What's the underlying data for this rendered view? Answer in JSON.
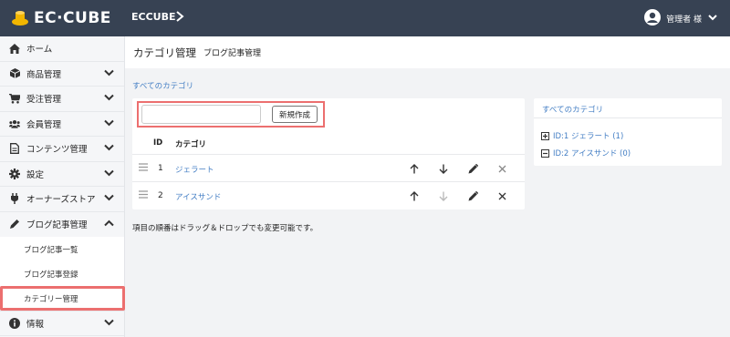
{
  "topbar": {
    "logo_text": "EC·CUBE",
    "shop_name": "ECCUBE",
    "user_name": "管理者 様"
  },
  "sidebar": {
    "items": [
      {
        "label": "ホーム",
        "icon": "home-icon"
      },
      {
        "label": "商品管理",
        "icon": "box-icon"
      },
      {
        "label": "受注管理",
        "icon": "cart-icon"
      },
      {
        "label": "会員管理",
        "icon": "users-icon"
      },
      {
        "label": "コンテンツ管理",
        "icon": "file-icon"
      },
      {
        "label": "設定",
        "icon": "gear-icon"
      },
      {
        "label": "オーナーズストア",
        "icon": "plug-icon"
      },
      {
        "label": "ブログ記事管理",
        "icon": "pen-icon"
      },
      {
        "label": "情報",
        "icon": "info-icon"
      }
    ],
    "subitems": [
      {
        "label": "ブログ記事一覧"
      },
      {
        "label": "ブログ記事登録"
      },
      {
        "label": "カテゴリー管理"
      }
    ]
  },
  "header": {
    "title": "カテゴリ管理",
    "subtitle": "ブログ記事管理"
  },
  "breadcrumb": "すべてのカテゴリ",
  "form": {
    "name_placeholder": "",
    "create_label": "新規作成"
  },
  "table": {
    "columns": [
      "ID",
      "カテゴリ"
    ],
    "rows": [
      {
        "id": "1",
        "name": "ジェラート"
      },
      {
        "id": "2",
        "name": "アイスサンド"
      }
    ]
  },
  "hint": "項目の順番はドラッグ＆ドロップでも変更可能です。",
  "tree": {
    "title": "すべてのカテゴリ",
    "items": [
      {
        "label": "ID:1 ジェラート (1)"
      },
      {
        "label": "ID:2 アイスサンド (0)"
      }
    ]
  },
  "colors": {
    "topbar": "#374253",
    "link": "#437ec4",
    "highlight": "#ec6f6f",
    "logo_accent": "#f2b600"
  }
}
